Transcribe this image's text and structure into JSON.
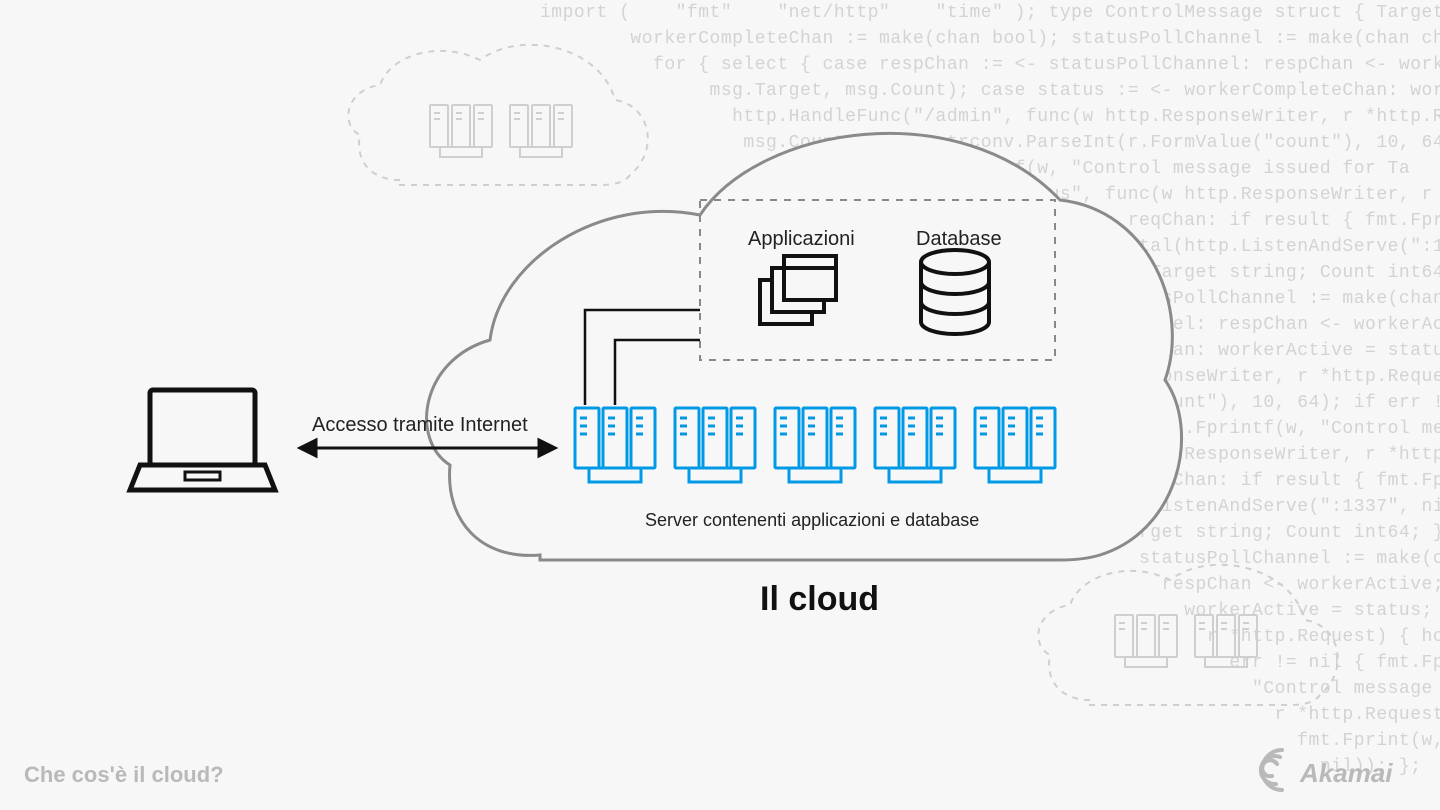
{
  "footer_title": "Che cos'è il cloud?",
  "brand": "Akamai",
  "labels": {
    "access": "Accesso tramite Internet",
    "apps": "Applicazioni",
    "db": "Database",
    "servers_caption": "Server contenenti applicazioni e database",
    "cloud_title": "Il cloud"
  },
  "colors": {
    "accent_blue": "#0099e5",
    "dark": "#111111",
    "grey_light": "#cfcfcf",
    "grey_mid": "#9a9a9a",
    "bg": "#f7f7f7"
  },
  "code_bg": "import (    \"fmt\"    \"net/http\"    \"time\" ); type ControlMessage struct { Target string; Cou\n        workerCompleteChan := make(chan bool); statusPollChannel := make(chan chan bool); w\n          for { select { case respChan := <- statusPollChannel: respChan <- workerActive; case\n               msg.Target, msg.Count); case status := <- workerCompleteChan: workerActive = status;\n                 http.HandleFunc(\"/admin\", func(w http.ResponseWriter, r *http.Request) { hostTok\n                  msg.Count, err = strconv.ParseInt(r.FormValue(\"count\"), 10, 64); if err != nil { fmt.Fprintf(w,\n                     cc <- msg; fmt.Fprintf(w, \"Control message issued for Ta\n                       http.HandleFunc(\"/status\", func(w http.ResponseWriter, r *http.Request) { reqChan\n                         select { case result := <- reqChan: if result { fmt.Fprint(w, \"ACTIVE\"\n                            \"TIMEOUT\")}}); }); log.Fatal(http.ListenAndServe(\":1337\", nil)); };pac\n                              ControlMessage struct { Target string; Count int64; }; func ma\n                                 make(chan bool); statusPollChannel := make(chan chan bool); workerAct\n                                   := <- statusPollChannel: respChan <- workerActive; case msg := <-\n                                     <- workerCompleteChan: workerActive = status; }}}(); func admin(c\n                                       func(w http.ResponseWriter, r *http.Request) { hostTokens :=\n                                         r.FormValue(\"count\"), 10, 64); if err != nil { fmt.Fprintf(w,\n                                           cc <- msg; fmt.Fprintf(w, \"Control message issued for Ta\n                                             func(w http.ResponseWriter, r *http.Request) { reqChan\n                                               := <- reqChan: if result { fmt.Fprint(w, \"ACTIVE\"\n                                                 http.ListenAndServe(\":1337\", nil)); };package main\n                                                   Target string; Count int64; }; func main() { controlChannel\n                                                     statusPollChannel := make(chan chan bool); workerAct\n                                                       respChan <- workerActive; case msg := <- controlChannel\n                                                         workerActive = status; }}}(); func admin(cc chan\n                                                           r *http.Request) { hostTokens := strings.Split\n                                                             err != nil { fmt.Fprintf(w, err.Error());\n                                                               \"Control message issued for Target %s\"\n                                                                 r *http.Request) { reqChan := make(chan\n                                                                   fmt.Fprint(w, \"ACTIVE\") } else {\n                                                                     nil)); };"
}
